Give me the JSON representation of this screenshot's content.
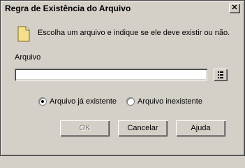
{
  "window": {
    "title": "Regra de Existência do Arquivo",
    "close_glyph": "✕"
  },
  "intro_text": "Escolha um arquivo e indique se ele deve existir ou não.",
  "file": {
    "label": "Arquivo",
    "value": "",
    "browse_icon": "list-browse-icon"
  },
  "options": {
    "existing_label": "Arquivo já existente",
    "nonexisting_label": "Arquivo inexistente",
    "selected": "existing"
  },
  "buttons": {
    "ok_label": "OK",
    "cancel_label": "Cancelar",
    "help_label": "Ajuda"
  },
  "colors": {
    "face": "#d4d0c8",
    "disabled_text": "#808080"
  }
}
